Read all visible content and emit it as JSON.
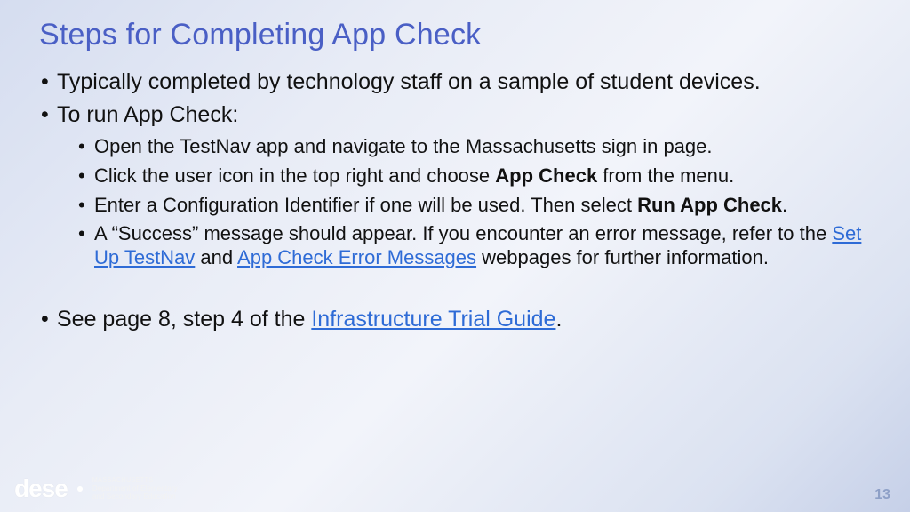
{
  "title": "Steps for Completing App Check",
  "bullets": {
    "b1": "Typically completed by technology staff on a sample of student devices.",
    "b2": "To run App Check:",
    "sub1": "Open the TestNav app and navigate to the Massachusetts sign in page.",
    "sub2_a": "Click the user icon in the top right and choose ",
    "sub2_bold": "App Check",
    "sub2_b": " from the menu.",
    "sub3_a": "Enter a Configuration Identifier if one will be used. Then select ",
    "sub3_bold": "Run App Check",
    "sub3_b": ".",
    "sub4_a": "A “Success” message should appear. If you encounter an error message, refer to the ",
    "sub4_link1": "Set Up TestNav",
    "sub4_mid": " and ",
    "sub4_link2": "App Check Error Messages",
    "sub4_b": " webpages for further information.",
    "b3_a": "See page 8, step 4 of the ",
    "b3_link": "Infrastructure Trial Guide",
    "b3_b": "."
  },
  "footer": {
    "wordmark": "dese",
    "line1": "MASSACHUSETTS",
    "line2": "Department of Elementary",
    "line3": "and Secondary Education"
  },
  "page_number": "13"
}
